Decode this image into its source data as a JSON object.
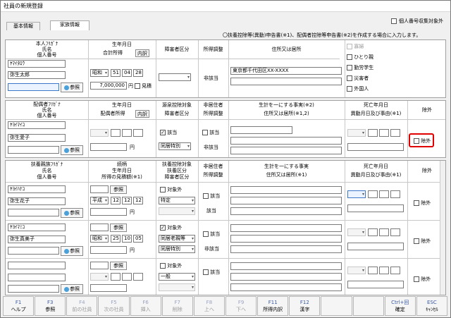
{
  "window": {
    "title": "社員の新規登録"
  },
  "tabs": [
    {
      "label": "基本情報"
    },
    {
      "label": "家族情報"
    }
  ],
  "top_checkbox": {
    "label": "個人番号収集対象外"
  },
  "note": "〇扶養控除等(異動)申告書(※1)、配偶者控除等申告書(※2)を作成する場合に入力します。",
  "self": {
    "headers": {
      "name_col": [
        "本人ﾌﾘｶﾞﾅ",
        "氏名",
        "個人番号"
      ],
      "birth": "生年月日",
      "income": "合計所得",
      "breakdown_btn": "内訳",
      "disability": "障害者区分",
      "income_adjust": "所得調整",
      "address": "住所又は居所"
    },
    "kana": "ﾔﾏｲﾀﾛｳ",
    "name": "弥生太郎",
    "ref_btn": "参照",
    "era": "昭和",
    "year": "51",
    "month": "04",
    "day": "28",
    "income_value": "7,000,000",
    "yen": "円",
    "estimate_label": "見積",
    "adjust_text": "非該当",
    "address_value": "東京都千代田区XX-XXXX",
    "checks": [
      {
        "label": "寡婦"
      },
      {
        "label": "ひとり親"
      },
      {
        "label": "勤労学生"
      },
      {
        "label": "災害者"
      },
      {
        "label": "外国人"
      }
    ]
  },
  "spouse": {
    "headers": {
      "name_col": [
        "配偶者ﾌﾘｶﾞﾅ",
        "氏名",
        "個人番号"
      ],
      "birth": "生年月日",
      "income": "配偶者所得",
      "breakdown_btn": "内訳",
      "source_title": "源泉控除対象",
      "disability": "障害者区分",
      "nonres_title": "非居住者",
      "income_adjust": "所得調整",
      "household_title": "生計を一にする事実(※2)",
      "address": "住所又は居所(※1,2)",
      "death_title": "死亡年月日",
      "change_title": "異動月日及び事由(※1)",
      "exclude": "除外"
    },
    "kana": "ﾔﾖｲﾏｲｺ",
    "name": "弥生愛子",
    "ref_btn": "参照",
    "yen": "円",
    "applicable": "該当",
    "cohabit": "同居特別",
    "nonres_applicable": "該当",
    "not_applicable": "非該当",
    "exclude_label": "除外"
  },
  "dependents": {
    "headers": {
      "name_col": [
        "扶養親族ﾌﾘｶﾞﾅ",
        "氏名",
        "個人番号"
      ],
      "relation": "続柄",
      "birth": "生年月日",
      "income": "所得の見積額(※1)",
      "dep_title": "扶養控除対象",
      "dep_class": "扶養区分",
      "disability": "障害者区分",
      "nonres_title": "非居住者",
      "income_adjust": "所得調整",
      "household_title": "生計を一にする事実",
      "address": "住所又は居所(※1)",
      "death_title": "死亡年月日",
      "change_title": "異動月日及び事由(※1)",
      "exclude": "除外"
    },
    "rows": [
      {
        "kana": "ﾔﾖｲﾊﾅｺ",
        "name": "弥生花子",
        "relation_btn": "参照",
        "era": "平成",
        "year": "12",
        "month": "12",
        "day": "12",
        "dep_check": "対象外",
        "dep_class": "特定",
        "nonres": "該当",
        "adjust": "該当",
        "exclude": "除外"
      },
      {
        "kana": "ﾔﾖｲﾏﾐｺ",
        "name": "弥生真美子",
        "relation_btn": "参照",
        "era": "昭和",
        "year": "25",
        "month": "10",
        "day": "05",
        "dep_check": "対象外",
        "dep_class": "同居老親等",
        "disability": "同居特別",
        "nonres": "該当",
        "adjust": "非該当",
        "exclude": "除外"
      },
      {
        "kana": "",
        "name": "",
        "relation_btn": "参照",
        "era": "",
        "year": "",
        "month": "",
        "day": "",
        "dep_check": "対象外",
        "dep_class": "一般",
        "nonres": "該当",
        "adjust": "",
        "exclude": "除外"
      }
    ],
    "ref_btn": "参照",
    "yen": "円"
  },
  "fkeys": [
    {
      "key": "F1",
      "label": "ヘルプ",
      "enabled": true
    },
    {
      "key": "F3",
      "label": "参照",
      "enabled": true
    },
    {
      "key": "F4",
      "label": "前の社員",
      "enabled": false
    },
    {
      "key": "F5",
      "label": "次の社員",
      "enabled": false
    },
    {
      "key": "F6",
      "label": "挿入",
      "enabled": false
    },
    {
      "key": "F7",
      "label": "削除",
      "enabled": false
    },
    {
      "key": "F8",
      "label": "上へ",
      "enabled": false
    },
    {
      "key": "F9",
      "label": "下へ",
      "enabled": false
    },
    {
      "key": "F11",
      "label": "所得内訳",
      "enabled": true
    },
    {
      "key": "F12",
      "label": "漢字",
      "enabled": true
    },
    {
      "key": "",
      "label": "",
      "enabled": false
    },
    {
      "key": "",
      "label": "",
      "enabled": false
    },
    {
      "key": "Ctrl+回",
      "label": "確定",
      "enabled": true
    },
    {
      "key": "ESC",
      "label": "ｷｬﾝｾﾙ",
      "enabled": true
    }
  ]
}
